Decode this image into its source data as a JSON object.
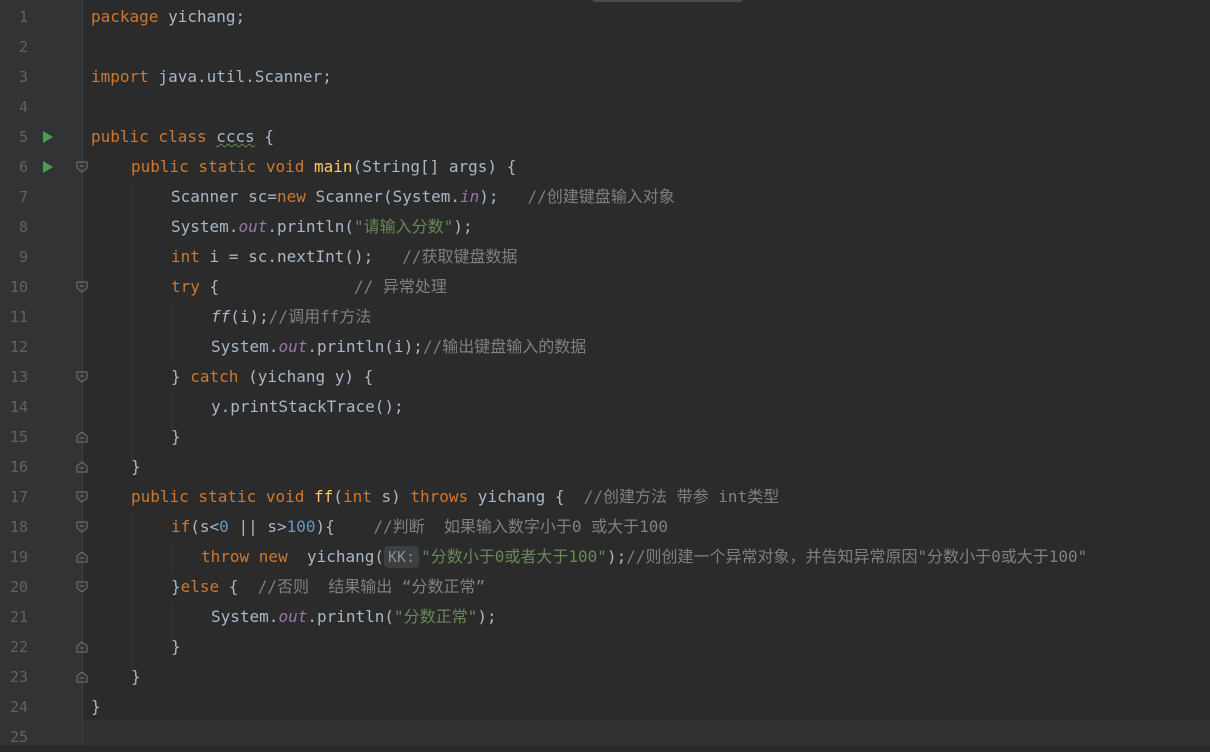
{
  "editor": {
    "line_numbers": [
      "1",
      "2",
      "3",
      "4",
      "5",
      "6",
      "7",
      "8",
      "9",
      "10",
      "11",
      "12",
      "13",
      "14",
      "15",
      "16",
      "17",
      "18",
      "19",
      "20",
      "21",
      "22",
      "23",
      "24",
      "25"
    ],
    "colors": {
      "background": "#2b2b2b",
      "keyword": "#cc7832",
      "string": "#6a8759",
      "comment": "#808080",
      "number": "#6897bb",
      "method": "#ffc66d",
      "field": "#9876aa"
    },
    "inlay_hint": "KK:",
    "lines": {
      "l1": {
        "kw": "package",
        "rest": " yichang;"
      },
      "l3": {
        "kw": "import",
        "rest": " java.util.Scanner;"
      },
      "l5": {
        "kw": "public class ",
        "name": "cccs",
        "rest": " {"
      },
      "l6": {
        "kw": "public static void ",
        "fn": "main",
        "rest": "(String[] args) {"
      },
      "l7": {
        "a": "Scanner sc=",
        "kw": "new",
        "b": " Scanner(System.",
        "field": "in",
        "c": ");   ",
        "cmt": "//创建键盘输入对象"
      },
      "l8": {
        "a": "System.",
        "field": "out",
        "b": ".println(",
        "str": "\"请输入分数\"",
        "c": ");"
      },
      "l9": {
        "kw": "int",
        "a": " i = sc.nextInt();   ",
        "cmt": "//获取键盘数据"
      },
      "l10": {
        "kw": "try",
        "a": " {              ",
        "cmt": "// 异常处理"
      },
      "l11": {
        "ital": "ff",
        "a": "(i);",
        "cmt": "//调用ff方法"
      },
      "l12": {
        "a": "System.",
        "field": "out",
        "b": ".println(i);",
        "cmt": "//输出键盘输入的数据"
      },
      "l13": {
        "a": "} ",
        "kw": "catch",
        "b": " (yichang y) {"
      },
      "l14": {
        "a": "y.printStackTrace();"
      },
      "l15": {
        "a": "}"
      },
      "l16": {
        "a": "}"
      },
      "l17": {
        "kw1": "public static void ",
        "fn": "ff",
        "a": "(",
        "kw2": "int",
        "b": " s) ",
        "kw3": "throws",
        "c": " yichang {  ",
        "cmt": "//创建方法 带参 int类型"
      },
      "l18": {
        "kw": "if",
        "a": "(s<",
        "n1": "0",
        "b": " || s>",
        "n2": "100",
        "c": "){    ",
        "cmt": "//判断  如果输入数字小于0 或大于100"
      },
      "l19": {
        "kw": "throw new",
        "a": "  yichang(",
        "str": "\"分数小于0或者大于100\"",
        "b": ");",
        "cmt": "//则创建一个异常对象，并告知异常原因\"分数小于0或大于100\""
      },
      "l20": {
        "a": "}",
        "kw": "else",
        "b": " {  ",
        "cmt": "//否则  结果输出 “分数正常”"
      },
      "l21": {
        "a": "System.",
        "field": "out",
        "b": ".println(",
        "str": "\"分数正常\"",
        "c": ");"
      },
      "l22": {
        "a": "}"
      },
      "l23": {
        "a": "}"
      },
      "l24": {
        "a": "}"
      }
    }
  }
}
